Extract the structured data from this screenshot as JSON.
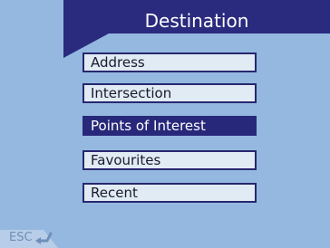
{
  "header": {
    "title": "Destination"
  },
  "menu": {
    "items": [
      {
        "label": "Address",
        "selected": false
      },
      {
        "label": "Intersection",
        "selected": false
      },
      {
        "label": "Points of Interest",
        "selected": true
      },
      {
        "label": "Favourites",
        "selected": false
      },
      {
        "label": "Recent",
        "selected": false
      }
    ]
  },
  "footer": {
    "esc_label": "ESC",
    "esc_icon": "return-arrow-icon"
  },
  "colors": {
    "background": "#94b8e0",
    "header": "#2a2a7e",
    "button_fill": "#e0ebf3",
    "button_border": "#27276f",
    "selected_fill": "#28287a"
  }
}
